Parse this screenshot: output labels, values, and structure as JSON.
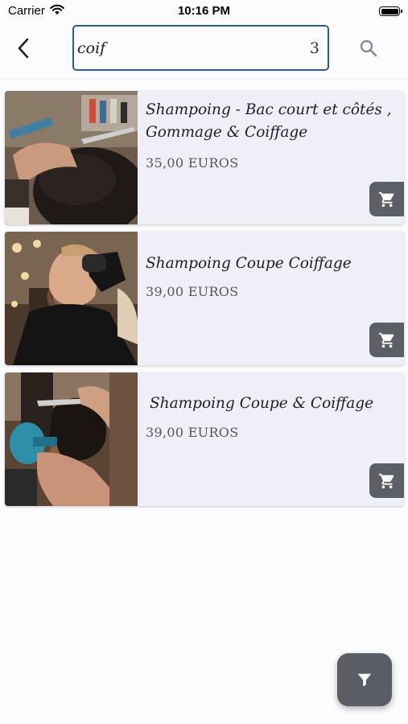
{
  "status_bar": {
    "carrier": "Carrier",
    "time": "10:16 PM"
  },
  "search": {
    "value": "coif",
    "result_count": "3"
  },
  "products": [
    {
      "title": "Shampoing - Bac court et côtés , Gommage & Coiffage",
      "price": "35,00 EUROS",
      "cart_icon": "cart-icon"
    },
    {
      "title": "Shampoing Coupe Coiffage",
      "price": "39,00 EUROS",
      "cart_icon": "cart-icon"
    },
    {
      "title": "Shampoing Coupe & Coiffage",
      "price": "39,00 EUROS",
      "cart_icon": "cart-icon"
    }
  ],
  "icons": {
    "back": "chevron-left-icon",
    "search": "search-icon",
    "filter": "filter-icon",
    "cart": "cart-icon"
  },
  "colors": {
    "accent_border": "#2e5a93",
    "card_bg": "#efeff8",
    "cart_button": "#5d5f66",
    "fab": "#5a5d64"
  }
}
